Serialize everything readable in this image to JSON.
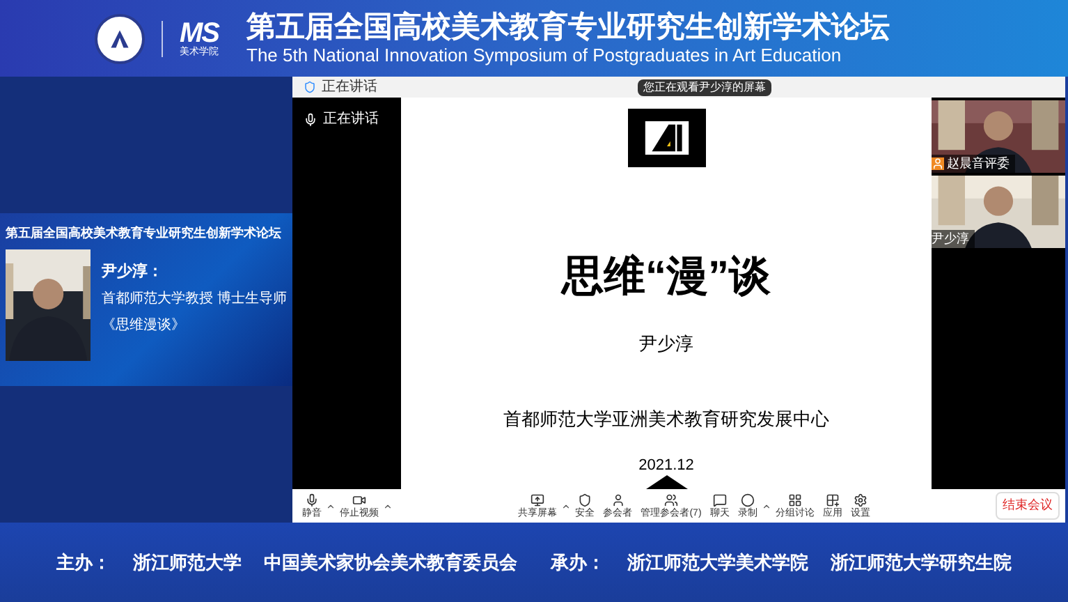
{
  "header": {
    "brand_mark": "MS",
    "brand_caption": "美术学院",
    "title": "第五届全国高校美术教育专业研究生创新学术论坛",
    "subtitle": "The 5th National Innovation Symposium of Postgraduates in Art Education"
  },
  "speaker_card": {
    "title": "第五届全国高校美术教育专业研究生创新学术论坛",
    "name": "尹少淳：",
    "role": "首都师范大学教授  博士生导师",
    "talk": "《思维漫谈》"
  },
  "meeting": {
    "speaking_label": "正在讲话",
    "panel_label": "正在讲话",
    "viewing_notice": "您正在观看尹少淳的屏幕",
    "slide": {
      "title": "思维“漫”谈",
      "author": "尹少淳",
      "org": "首都师范大学亚洲美术教育研究发展中心",
      "date": "2021.12"
    },
    "videos": [
      {
        "name": "赵晨音评委",
        "host": true
      },
      {
        "name": "尹少淳",
        "host": false
      }
    ],
    "toolbar": [
      {
        "label": "静音",
        "kind": "mic",
        "caret": true
      },
      {
        "label": "停止视频",
        "kind": "camera",
        "caret": true
      },
      {
        "label": "共享屏幕",
        "kind": "share",
        "caret": true
      },
      {
        "label": "安全",
        "kind": "shield",
        "caret": false
      },
      {
        "label": "参会者",
        "kind": "person",
        "caret": false
      },
      {
        "label": "管理参会者(7)",
        "kind": "people",
        "caret": false
      },
      {
        "label": "聊天",
        "kind": "chat",
        "caret": false
      },
      {
        "label": "录制",
        "kind": "record",
        "caret": true
      },
      {
        "label": "分组讨论",
        "kind": "groups",
        "caret": false
      },
      {
        "label": "应用",
        "kind": "apps",
        "caret": false
      },
      {
        "label": "设置",
        "kind": "gear",
        "caret": false
      }
    ],
    "end_button": "结束会议"
  },
  "footer": {
    "organizers_label": "主办：",
    "organizers": [
      "浙江师范大学",
      "中国美术家协会美术教育委员会"
    ],
    "hosts_label": "承办：",
    "hosts": [
      "浙江师范大学美术学院",
      "浙江师范大学研究生院"
    ]
  }
}
